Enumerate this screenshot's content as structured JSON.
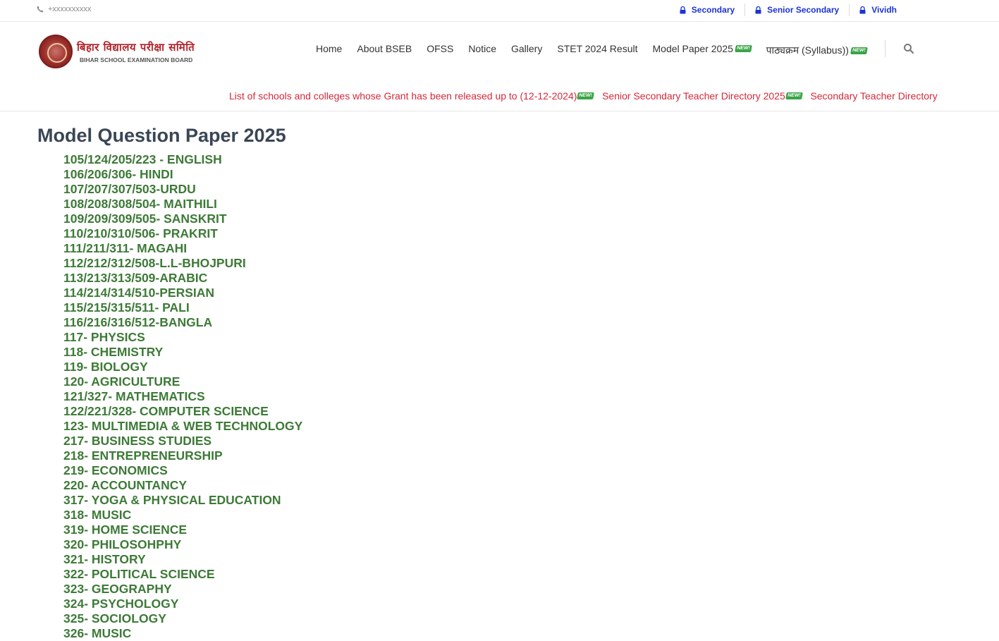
{
  "topbar": {
    "phone": "+xxxxxxxxxx",
    "links": [
      {
        "label": "Secondary"
      },
      {
        "label": "Senior Secondary"
      },
      {
        "label": "Vividh"
      }
    ]
  },
  "logo": {
    "hindi": "बिहार विद्यालय परीक्षा समिति",
    "english": "BIHAR SCHOOL EXAMINATION BOARD"
  },
  "nav": {
    "items": [
      "Home",
      "About BSEB",
      "OFSS",
      "Notice",
      "Gallery",
      "STET 2024 Result"
    ],
    "model_paper": "Model Paper 2025",
    "syllabus": "पाठ्यक्रम (Syllabus))",
    "new_badge": "NEW!"
  },
  "marquee": {
    "items": [
      "List of schools and colleges whose Grant has been released up to (12-12-2024)",
      "Senior Secondary Teacher Directory 2025",
      "Secondary Teacher Directory"
    ]
  },
  "page": {
    "title": "Model Question Paper 2025"
  },
  "papers": [
    "105/124/205/223 - ENGLISH",
    "106/206/306- HINDI",
    "107/207/307/503-URDU",
    "108/208/308/504- MAITHILI",
    "109/209/309/505- SANSKRIT",
    "110/210/310/506- PRAKRIT",
    "111/211/311- MAGAHI",
    "112/212/312/508-L.L-BHOJPURI",
    "113/213/313/509-ARABIC",
    "114/214/314/510-PERSIAN",
    "115/215/315/511- PALI",
    "116/216/316/512-BANGLA",
    "117- PHYSICS",
    "118- CHEMISTRY",
    "119- BIOLOGY",
    "120- AGRICULTURE",
    "121/327- MATHEMATICS",
    "122/221/328- COMPUTER SCIENCE",
    "123- MULTIMEDIA & WEB TECHNOLOGY",
    "217- BUSINESS STUDIES",
    "218- ENTREPRENEURSHIP",
    "219- ECONOMICS",
    "220- ACCOUNTANCY",
    "317- YOGA & PHYSICAL EDUCATION",
    "318- MUSIC",
    "319- HOME SCIENCE",
    "320- PHILOSOHPHY",
    "321- HISTORY",
    "322- POLITICAL SCIENCE",
    "323- GEOGRAPHY",
    "324- PSYCHOLOGY",
    "325- SOCIOLOGY",
    "326- MUSIC"
  ],
  "colors": {
    "nav_link": "#1a33d6",
    "marquee": "#d6283a",
    "paper_link": "#3d7a37",
    "title": "#3a4655",
    "badge": "#3aa447"
  }
}
